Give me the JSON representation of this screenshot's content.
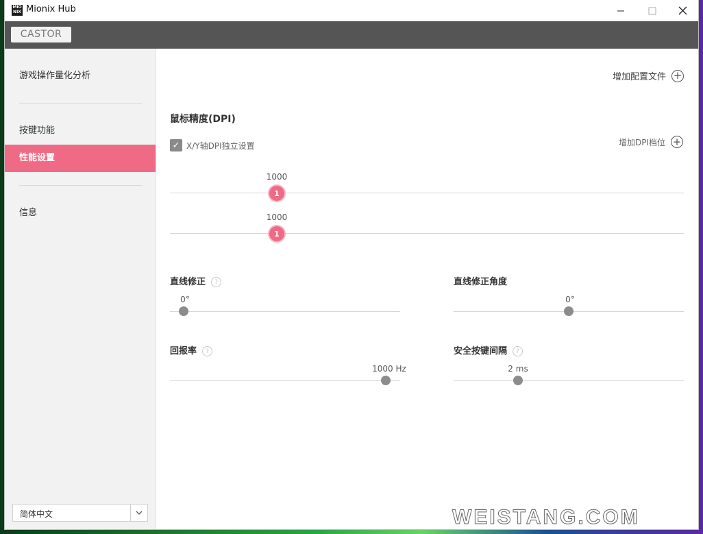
{
  "window": {
    "title": "Mionix Hub",
    "logo": "MIO NIX"
  },
  "device": {
    "tab_label": "CASTOR"
  },
  "sidebar": {
    "items": [
      {
        "label": "游戏操作量化分析"
      },
      {
        "label": "按键功能"
      },
      {
        "label": "性能设置",
        "active": true
      },
      {
        "label": "信息"
      }
    ],
    "language": {
      "selected": "简体中文"
    }
  },
  "main": {
    "add_profile_label": "增加配置文件",
    "dpi": {
      "title": "鼠标精度(DPI)",
      "checkbox_label": "X/Y轴DPI独立设置",
      "checkbox_checked": true,
      "add_level_label": "增加DPI档位",
      "x_value": "1000",
      "x_level": "1",
      "y_value": "1000",
      "y_level": "1"
    },
    "angle_snapping": {
      "title": "直线修正",
      "value": "0°"
    },
    "angle_snapping_angle": {
      "title": "直线修正角度",
      "value": "0°"
    },
    "polling_rate": {
      "title": "回报率",
      "value": "1000 Hz"
    },
    "debounce": {
      "title": "安全按键间隔",
      "value": "2 ms"
    }
  },
  "watermark": "WEISTANG.COM",
  "colors": {
    "accent": "#ef6a84",
    "header_bar": "#555555",
    "sidebar_bg": "#f2f2f2"
  },
  "icons": {
    "window_minimize": "minimize-icon",
    "window_maximize": "maximize-icon",
    "window_close": "close-icon"
  }
}
